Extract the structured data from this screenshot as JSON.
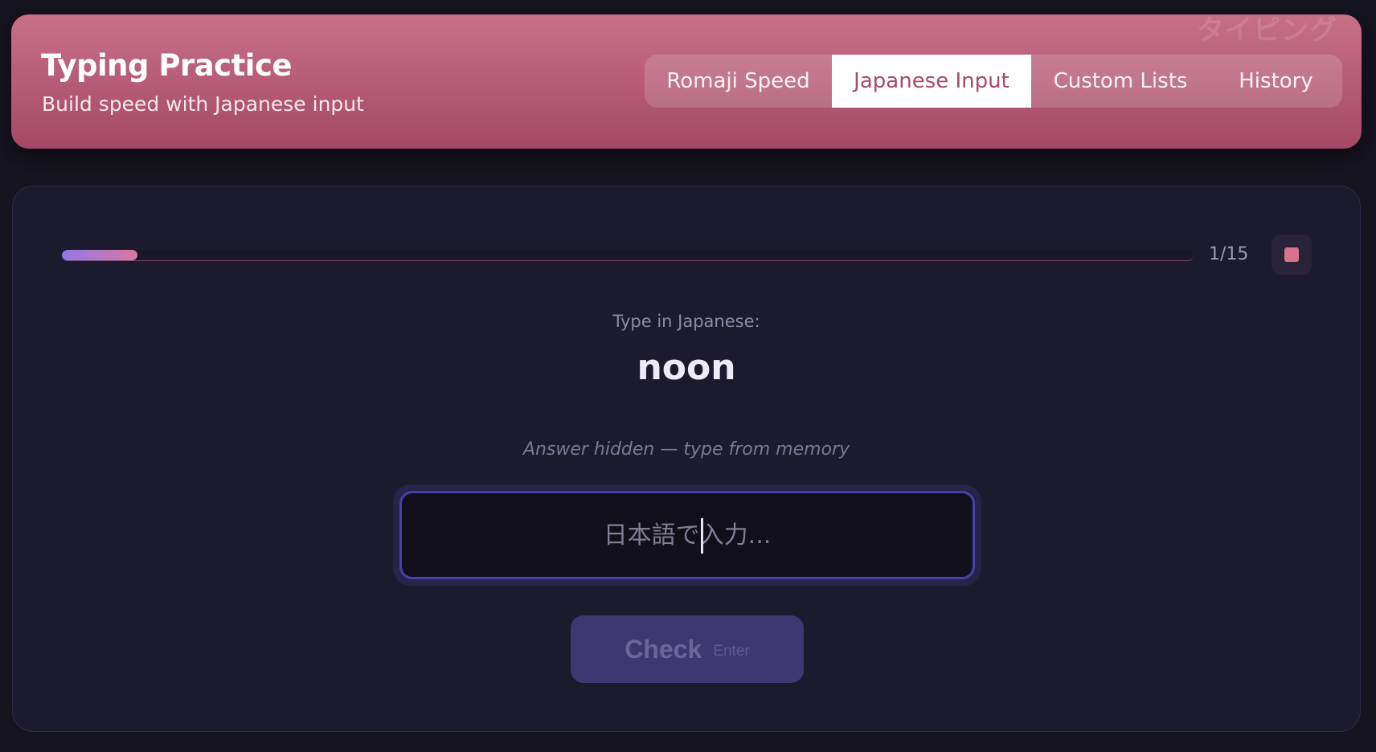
{
  "header": {
    "title": "Typing Practice",
    "subtitle": "Build speed with Japanese input",
    "watermark": "タイピング"
  },
  "tabs": [
    {
      "label": "Romaji Speed",
      "active": false
    },
    {
      "label": "Japanese Input",
      "active": true
    },
    {
      "label": "Custom Lists",
      "active": false
    },
    {
      "label": "History",
      "active": false
    }
  ],
  "progress": {
    "count_text": "1/15",
    "current": 1,
    "total": 15,
    "fraction": 0.0667
  },
  "stop_button": {
    "icon": "stop-icon"
  },
  "prompt": {
    "label": "Type in Japanese:",
    "word": "noon",
    "hint": "Answer hidden — type from memory"
  },
  "answer": {
    "value": "",
    "placeholder": "日本語で入力..."
  },
  "check_button": {
    "label": "Check",
    "shortcut": "Enter"
  },
  "colors": {
    "background": "#15141f",
    "header_gradient_top": "#c97088",
    "header_gradient_bottom": "#a44865",
    "panel": "#1c1b2e",
    "accent": "#4a3fae",
    "progress_start": "#8f78e6",
    "progress_end": "#d97aa0",
    "stop": "#d8728f"
  }
}
